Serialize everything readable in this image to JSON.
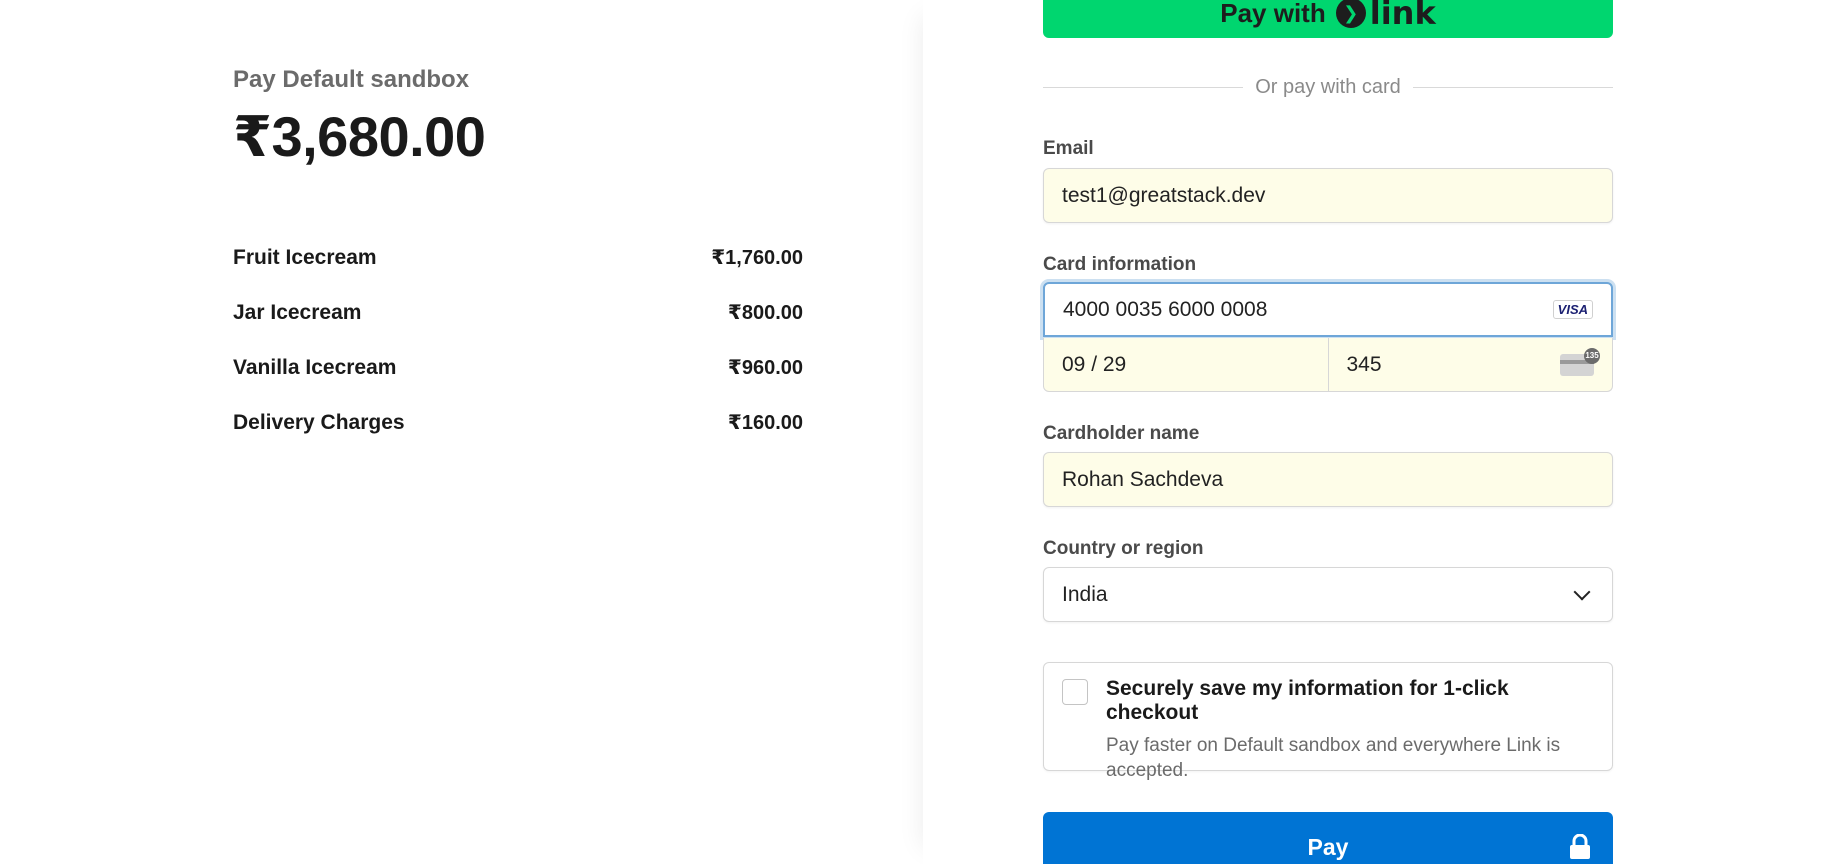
{
  "summary": {
    "merchant": "Pay Default sandbox",
    "total": "₹3,680.00",
    "items": [
      {
        "name": "Fruit Icecream",
        "price": "₹1,760.00"
      },
      {
        "name": "Jar Icecream",
        "price": "₹800.00"
      },
      {
        "name": "Vanilla Icecream",
        "price": "₹960.00"
      },
      {
        "name": "Delivery Charges",
        "price": "₹160.00"
      }
    ]
  },
  "link_button": {
    "prefix": "Pay with",
    "logo_text": "link"
  },
  "divider_text": "Or pay with card",
  "email": {
    "label": "Email",
    "value": "test1@greatstack.dev"
  },
  "card": {
    "label": "Card information",
    "number": "4000 0035 6000 0008",
    "brand": "VISA",
    "expiry": "09 / 29",
    "cvc": "345",
    "cvc_badge": "135"
  },
  "cardholder": {
    "label": "Cardholder name",
    "value": "Rohan Sachdeva"
  },
  "country": {
    "label": "Country or region",
    "selected": "India"
  },
  "save_info": {
    "title": "Securely save my information for 1-click checkout",
    "description": "Pay faster on Default sandbox and everywhere Link is accepted."
  },
  "pay_button": {
    "label": "Pay"
  },
  "colors": {
    "link_green": "#00d66f",
    "pay_blue": "#0074d4",
    "autofill_yellow": "#fefde8",
    "focus_blue": "#6ea6d8"
  }
}
